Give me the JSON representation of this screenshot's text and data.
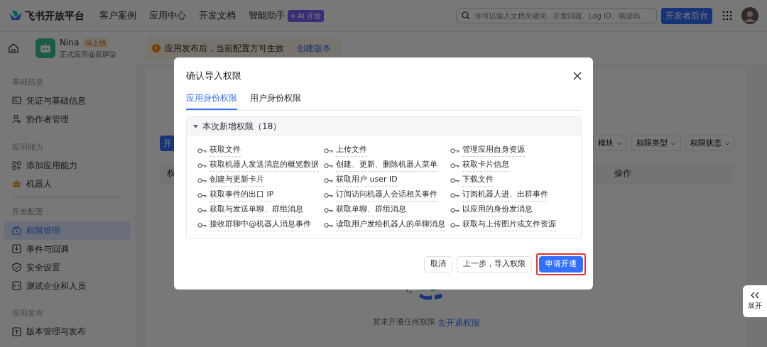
{
  "header": {
    "brand": "飞书开放平台",
    "nav": [
      {
        "label": "客户案例"
      },
      {
        "label": "应用中心"
      },
      {
        "label": "开发文档"
      },
      {
        "label": "智能助手",
        "badge": "AI 开发"
      }
    ],
    "search": {
      "placeholder": "你可以输入文档关键词、开发问题、Log ID、错误码"
    },
    "console_button": "开发者后台"
  },
  "app_bar": {
    "name": "Nina",
    "status": "待上线",
    "subtitle": "正式应用@辰肆柒",
    "notice": "应用发布后，当前配置方可生效",
    "notice_link": "创建版本"
  },
  "sidebar": {
    "sections": [
      {
        "title": "基础信息",
        "items": [
          {
            "label": "凭证与基础信息",
            "selected": false
          },
          {
            "label": "协作者管理",
            "selected": false
          }
        ]
      },
      {
        "title": "应用能力",
        "items": [
          {
            "label": "添加应用能力",
            "selected": false
          },
          {
            "label": "机器人",
            "selected": false
          }
        ]
      },
      {
        "title": "开发配置",
        "items": [
          {
            "label": "权限管理",
            "selected": true
          },
          {
            "label": "事件与回调",
            "selected": false
          },
          {
            "label": "安全设置",
            "selected": false
          },
          {
            "label": "测试企业和人员",
            "selected": false
          }
        ]
      },
      {
        "title": "应用发布",
        "items": [
          {
            "label": "版本管理与发布",
            "selected": false
          }
        ]
      }
    ]
  },
  "main": {
    "primary_button": "开",
    "filters": [
      "模块",
      "权限类型",
      "权限状态"
    ],
    "table_columns": [
      "权",
      "操作"
    ],
    "empty_text": "暂未开通任何权限",
    "empty_link": "去开通权限"
  },
  "expand_button": "展开",
  "modal": {
    "title": "确认导入权限",
    "tabs": [
      {
        "label": "应用身份权限",
        "selected": true
      },
      {
        "label": "用户身份权限",
        "selected": false
      }
    ],
    "group": {
      "title": "本次新增权限（18）",
      "expanded": true,
      "permissions": [
        "获取文件",
        "上传文件",
        "管理应用自身资源",
        "获取机器人发送消息的概览数据",
        "创建、更新、删除机器人菜单",
        "获取卡片信息",
        "创建与更新卡片",
        "获取用户 user ID",
        "下载文件",
        "获取事件的出口 IP",
        "订阅访问机器人会话相关事件",
        "订阅机器人进、出群事件",
        "获取与发送单聊、群组消息",
        "获取单聊、群组消息",
        "以应用的身份发消息",
        "接收群聊中@机器人消息事件",
        "读取用户发给机器人的单聊消息",
        "获取与上传图片或文件资源"
      ]
    },
    "buttons": [
      {
        "label": "取消",
        "kind": "default",
        "highlighted": false
      },
      {
        "label": "上一步，导入权限",
        "kind": "default",
        "highlighted": false
      },
      {
        "label": "申请开通",
        "kind": "primary",
        "highlighted": true
      }
    ]
  }
}
